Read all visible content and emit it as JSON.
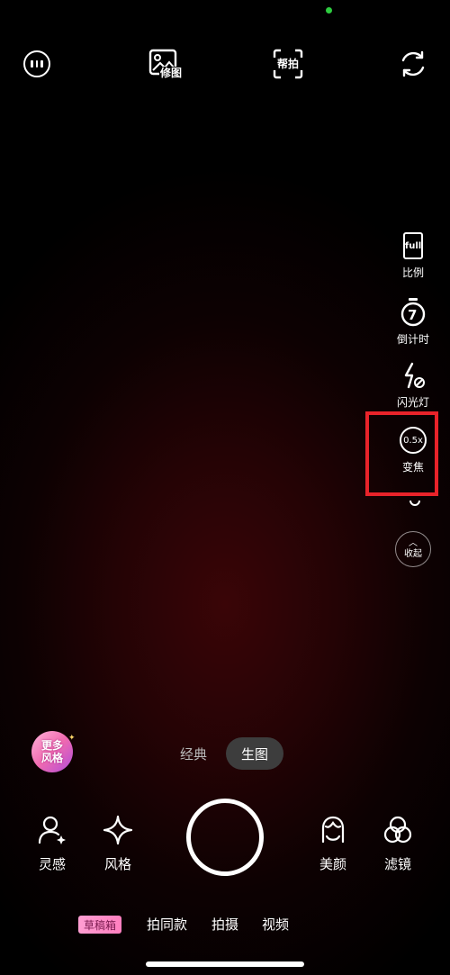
{
  "top_bar": {
    "menu_icon": "menu-circle-icon",
    "edit_label": "修图",
    "help_label": "帮拍",
    "flip_icon": "camera-flip-icon"
  },
  "side_toolbar": {
    "ratio": {
      "value": "full",
      "label": "比例"
    },
    "timer": {
      "value": "7",
      "label": "倒计时"
    },
    "flash": {
      "label": "闪光灯"
    },
    "zoom": {
      "value": "0.5x",
      "label": "变焦"
    },
    "collapse": {
      "label": "收起"
    }
  },
  "highlight_color": "#e8232a",
  "more_styles": {
    "line1": "更多",
    "line2": "风格"
  },
  "mode_switch": {
    "classic": "经典",
    "generate": "生图",
    "active": "生图"
  },
  "bottom_tools": {
    "inspiration": "灵感",
    "style": "风格",
    "beauty": "美颜",
    "filter": "滤镜"
  },
  "bottom_tabs": {
    "drafts": "草稿箱",
    "same_shot": "拍同款",
    "photo": "拍摄",
    "video": "视频"
  }
}
